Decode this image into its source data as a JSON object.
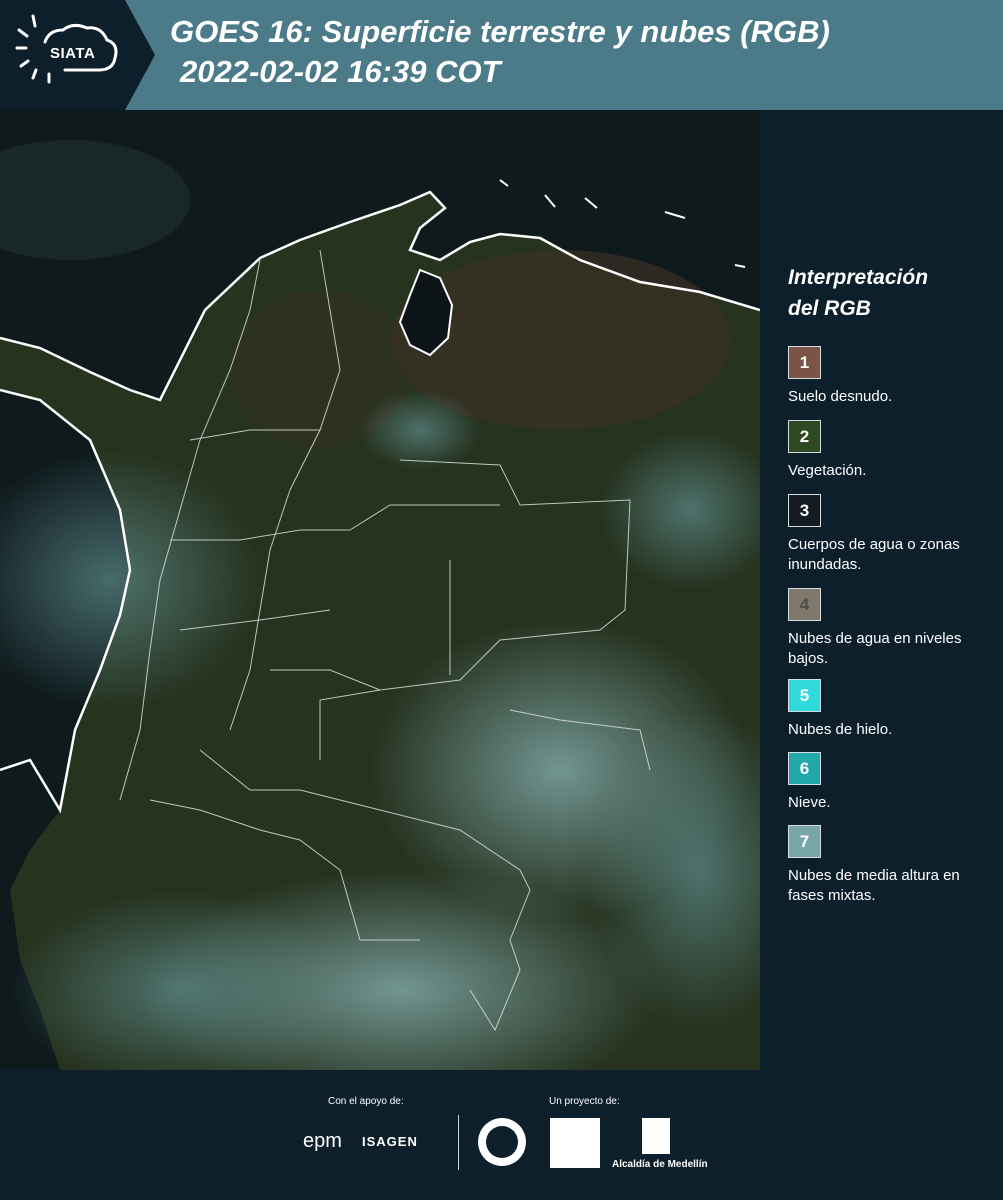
{
  "header": {
    "logo_text": "SIATA",
    "title_line1": "GOES 16: Superficie terrestre y nubes (RGB)",
    "title_line2": "2022-02-02 16:39 COT"
  },
  "legend": {
    "title_line1": "Interpretación",
    "title_line2": "del RGB",
    "items": [
      {
        "num": "1",
        "label": "Suelo desnudo.",
        "color": "#7a5444"
      },
      {
        "num": "2",
        "label": "Vegetación.",
        "color": "#2f4a22"
      },
      {
        "num": "3",
        "label": "Cuerpos de agua o zonas inundadas.",
        "color": "#121c22"
      },
      {
        "num": "4",
        "label": "Nubes de agua en niveles bajos.",
        "color": "#7f796d"
      },
      {
        "num": "5",
        "label": "Nubes de hielo.",
        "color": "#2fd9dc"
      },
      {
        "num": "6",
        "label": "Nieve.",
        "color": "#22a7ab"
      },
      {
        "num": "7",
        "label": "Nubes de media altura en fases mixtas.",
        "color": "#78a6a8"
      }
    ]
  },
  "footer": {
    "support_label": "Con el apoyo de:",
    "project_label": "Un proyecto de:",
    "epm": "epm",
    "isagen": "ISAGEN",
    "alcaldia": "Alcaldía de Medellín"
  }
}
